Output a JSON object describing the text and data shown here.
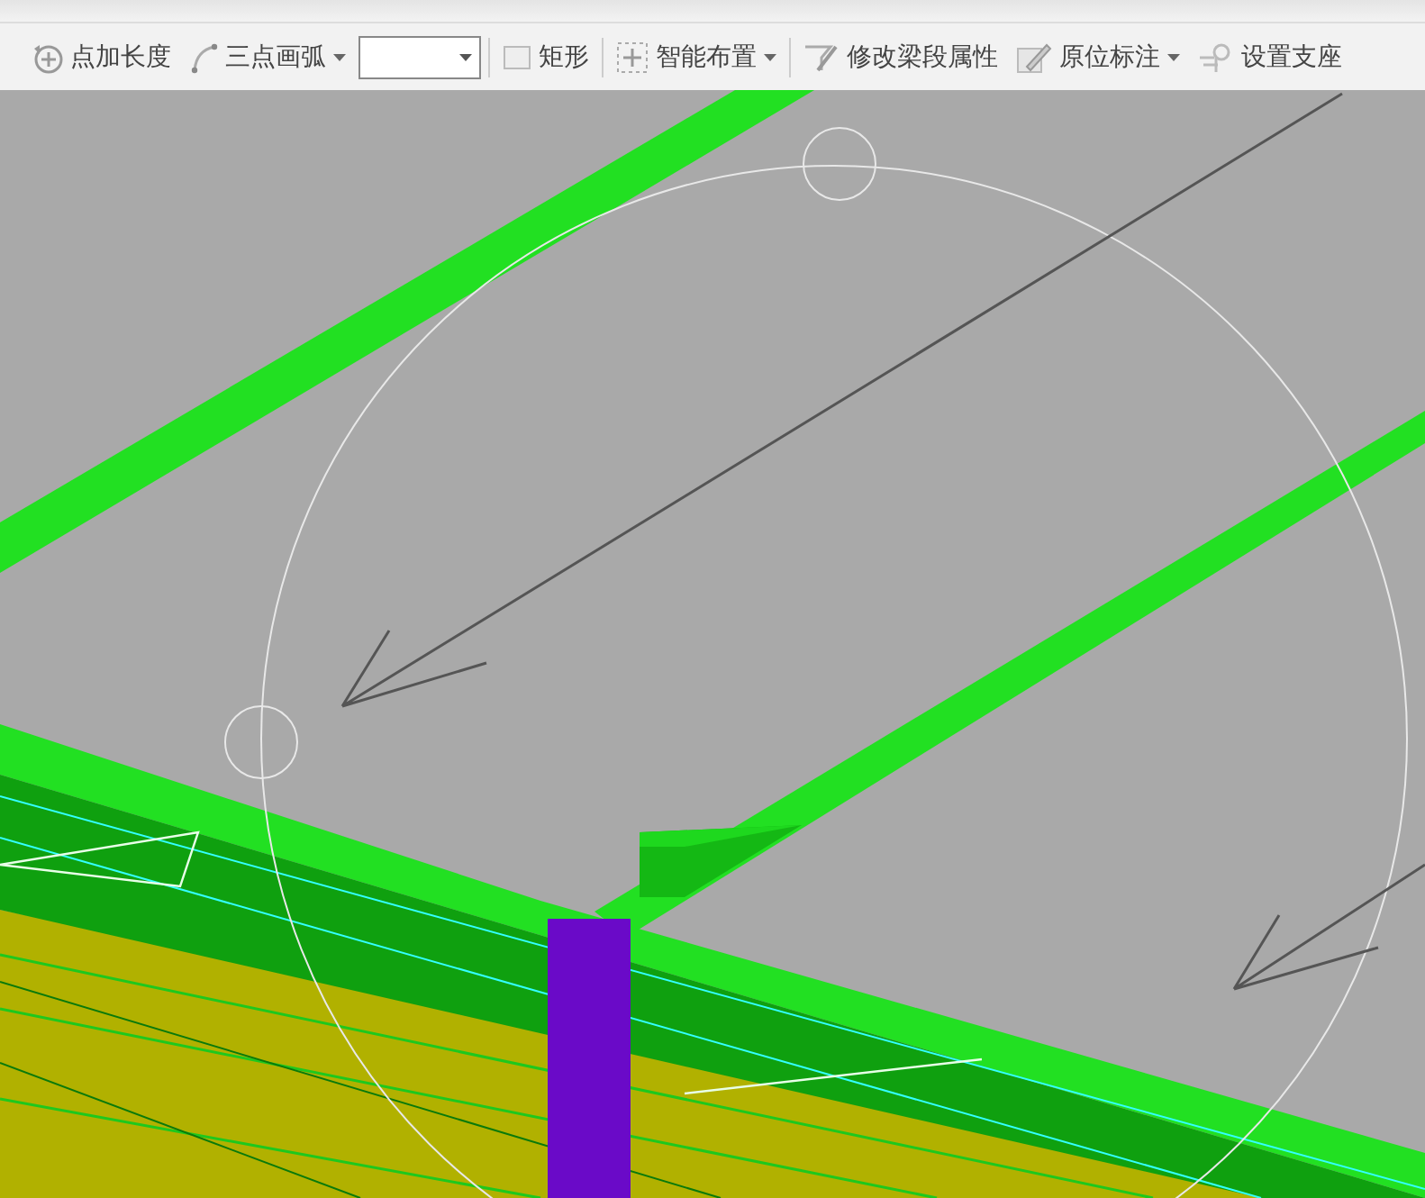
{
  "toolbar": {
    "items": [
      {
        "kind": "button",
        "label": "点加长度"
      },
      {
        "kind": "dropdown_button",
        "label": "三点画弧"
      },
      {
        "kind": "combo"
      },
      {
        "kind": "button",
        "label": "矩形"
      },
      {
        "kind": "dropdown_button",
        "label": "智能布置"
      },
      {
        "kind": "button",
        "label": "修改梁段属性"
      },
      {
        "kind": "dropdown_button",
        "label": "原位标注"
      },
      {
        "kind": "button",
        "label": "设置支座"
      }
    ]
  }
}
